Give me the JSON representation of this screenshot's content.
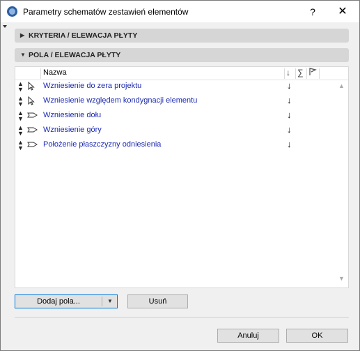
{
  "window": {
    "title": "Parametry schematów zestawień elementów",
    "help_label": "?",
    "close_label": "✕"
  },
  "sections": [
    {
      "label": "KRYTERIA /  ELEWACJA PŁYTY",
      "expanded": false
    },
    {
      "label": "POLA /  ELEWACJA PŁYTY",
      "expanded": true
    }
  ],
  "list": {
    "column_name": "Nazwa",
    "header_icons": [
      "sort-icon",
      "sum-icon",
      "flag-icon"
    ],
    "rows": [
      {
        "name": "Wzniesienie do zera projektu",
        "kind_icon": "pointer-icon"
      },
      {
        "name": "Wzniesienie względem kondygnacji elementu",
        "kind_icon": "pointer-icon"
      },
      {
        "name": "Wzniesienie dołu",
        "kind_icon": "tag-icon"
      },
      {
        "name": "Wzniesienie góry",
        "kind_icon": "tag-icon"
      },
      {
        "name": "Położenie płaszczyzny odniesienia",
        "kind_icon": "tag-icon"
      }
    ]
  },
  "buttons": {
    "add_fields": "Dodaj pola...",
    "remove": "Usuń",
    "cancel": "Anuluj",
    "ok": "OK"
  },
  "colors": {
    "link_text": "#1d2bb0",
    "default_button_border": "#0078d7",
    "section_header_bg": "#d6d6d6"
  }
}
